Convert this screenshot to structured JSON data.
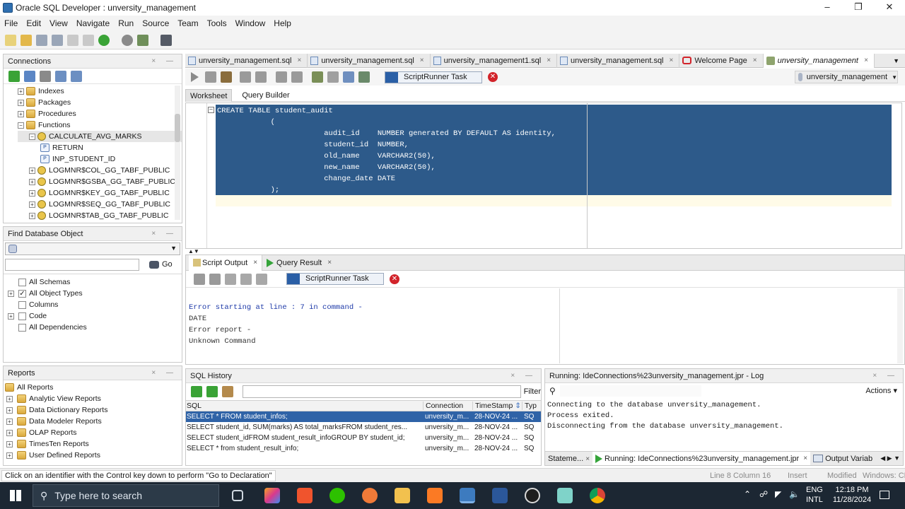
{
  "window": {
    "title": "Oracle SQL Developer : unversity_management"
  },
  "menu": [
    "File",
    "Edit",
    "View",
    "Navigate",
    "Run",
    "Source",
    "Team",
    "Tools",
    "Window",
    "Help"
  ],
  "connections": {
    "title": "Connections",
    "tree": [
      {
        "label": "Indexes",
        "level": 1,
        "icon": "folder-icon"
      },
      {
        "label": "Packages",
        "level": 1,
        "icon": "folder-icon"
      },
      {
        "label": "Procedures",
        "level": 1,
        "icon": "folder-icon"
      },
      {
        "label": "Functions",
        "level": 1,
        "icon": "folder-icon"
      },
      {
        "label": "CALCULATE_AVG_MARKS",
        "level": 2,
        "icon": "function-icon"
      },
      {
        "label": "RETURN",
        "level": 3,
        "icon": "parameter-icon"
      },
      {
        "label": "INP_STUDENT_ID",
        "level": 3,
        "icon": "parameter-icon"
      },
      {
        "label": "LOGMNR$COL_GG_TABF_PUBLIC",
        "level": 2,
        "icon": "function-icon"
      },
      {
        "label": "LOGMNR$GSBA_GG_TABF_PUBLIC",
        "level": 2,
        "icon": "function-icon"
      },
      {
        "label": "LOGMNR$KEY_GG_TABF_PUBLIC",
        "level": 2,
        "icon": "function-icon"
      },
      {
        "label": "LOGMNR$SEQ_GG_TABF_PUBLIC",
        "level": 2,
        "icon": "function-icon"
      },
      {
        "label": "LOGMNR$TAB_GG_TABF_PUBLIC",
        "level": 2,
        "icon": "function-icon"
      }
    ]
  },
  "find_db": {
    "title": "Find Database Object",
    "go_label": "Go",
    "options": [
      {
        "label": "All Schemas",
        "checked": false
      },
      {
        "label": "All Object Types",
        "checked": true
      },
      {
        "label": "Columns",
        "checked": false
      },
      {
        "label": "Code",
        "checked": false
      },
      {
        "label": "All Dependencies",
        "checked": false
      }
    ]
  },
  "reports": {
    "title": "Reports",
    "items": [
      "All Reports",
      "Analytic View Reports",
      "Data Dictionary Reports",
      "Data Modeler Reports",
      "OLAP Reports",
      "TimesTen Reports",
      "User Defined Reports"
    ]
  },
  "editor": {
    "tabs": [
      {
        "label": "unversity_management.sql",
        "active": false
      },
      {
        "label": "unversity_management.sql",
        "active": false
      },
      {
        "label": "unversity_management1.sql",
        "active": false
      },
      {
        "label": "unversity_management.sql",
        "active": false
      },
      {
        "label": "Welcome Page",
        "active": false
      },
      {
        "label": "unversity_management",
        "active": true
      }
    ],
    "task_label": "ScriptRunner Task",
    "connection": "unversity_management",
    "subtabs": [
      "Worksheet",
      "Query Builder"
    ],
    "code": [
      "CREATE TABLE student_audit",
      "            (",
      "                        audit_id    NUMBER generated BY DEFAULT AS identity,",
      "                        student_id  NUMBER,",
      "                        old_name    VARCHAR2(50),",
      "                        new_name    VARCHAR2(50),",
      "                        change_date DATE",
      "            );"
    ]
  },
  "output": {
    "tabs": [
      "Script Output",
      "Query Result"
    ],
    "task_label": "ScriptRunner Task",
    "lines": [
      "Error starting at line : 7 in command -",
      "DATE",
      "Error report -",
      "Unknown Command"
    ]
  },
  "history": {
    "title": "SQL History",
    "filter_label": "Filter",
    "columns": [
      "SQL",
      "Connection",
      "TimeStamp",
      "Typ"
    ],
    "rows": [
      {
        "sql": "SELECT * FROM  student_infos;",
        "conn": "unversity_m...",
        "ts": "28-NOV-24 ...",
        "typ": "SQ",
        "selected": true
      },
      {
        "sql": "SELECT student_id,       SUM(marks) AS total_marksFROM   student_res...",
        "conn": "unversity_m...",
        "ts": "28-NOV-24 ...",
        "typ": "SQ",
        "selected": false
      },
      {
        "sql": "SELECT student_idFROM   student_result_infoGROUP BY student_id;",
        "conn": "unversity_m...",
        "ts": "28-NOV-24 ...",
        "typ": "SQ",
        "selected": false
      },
      {
        "sql": "SELECT * from student_result_info;",
        "conn": "unversity_m...",
        "ts": "28-NOV-24 ...",
        "typ": "SQ",
        "selected": false
      }
    ]
  },
  "log": {
    "title": "Running: IdeConnections%23unversity_management.jpr - Log",
    "actions_label": "Actions",
    "lines": [
      "Connecting to the database unversity_management.",
      "Process exited.",
      "Disconnecting from the database unversity_management."
    ],
    "bottom_tabs": [
      "Stateme...",
      "Running: IdeConnections%23unversity_management.jpr",
      "Output Variab"
    ]
  },
  "status": {
    "hint": "Click on an identifier with the Control key down to perform \"Go to Declaration\"",
    "position": "Line 8 Column 16",
    "mode": "Insert",
    "modified": "Modified",
    "eol": "Windows: CR"
  },
  "taskbar": {
    "search_placeholder": "Type here to search",
    "lang": "ENG",
    "layout": "INTL",
    "time": "12:18 PM",
    "date": "11/28/2024"
  }
}
